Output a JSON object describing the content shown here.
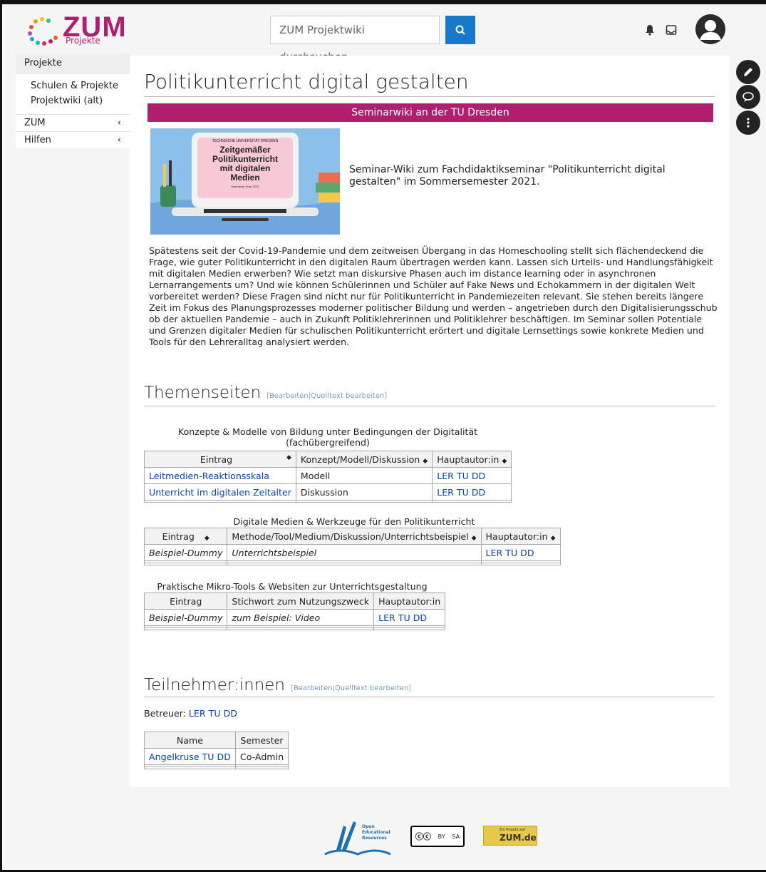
{
  "header": {
    "logo_text": "ZUM",
    "logo_sub": "Projekte",
    "search_placeholder": "ZUM Projektwiki durchsuchen"
  },
  "sidebar": {
    "head": "Projekte",
    "sub_items": [
      "Schulen & Projekte",
      "Projektwiki (alt)"
    ],
    "items": [
      {
        "label": "ZUM",
        "chevron": "‹"
      },
      {
        "label": "Hilfen",
        "chevron": "‹"
      }
    ]
  },
  "page": {
    "title": "Politikunterricht digital gestalten",
    "banner": "Seminarwiki an der TU Dresden",
    "hero": {
      "small": "TECHNISCHE UNIVERSITÄT DRESDEN",
      "l1": "Zeitgemäßer",
      "l2": "Politikunterricht",
      "l3": "mit digitalen",
      "l4": "Medien",
      "sub": "Sommerse­ Sose 2021"
    },
    "intro": "Seminar-Wiki zum Fachdidaktikseminar \"Politikunterricht digital gestalten\" im Sommersemester 2021.",
    "paragraph": "Spätestens seit der Covid-19-Pandemie und dem zeitweisen Übergang in das Homeschooling stellt sich flächendeckend die Frage, wie guter Politikunterricht in den digitalen Raum übertragen werden kann. Lassen sich Urteils- und Handlungsfähigkeit mit digitalen Medien erwerben? Wie setzt man diskursive Phasen auch im distance learning oder in asynchronen Lernarrangements um? Und wie können Schülerinnen und Schüler auf Fake News und Echokammern in der digitalen Welt vorbereitet werden? Diese Fragen sind nicht nur für Politikunterricht in Pandemiezeiten relevant. Sie stehen bereits längere Zeit im Fokus des Planungsprozesses moderner politischer Bildung und werden – angetrieben durch den Digitalisierungsschub ob der aktuellen Pandemie – auch in Zukunft Politiklehrerinnen und Politiklehrer beschäftigen. Im Seminar sollen Potentiale und Grenzen digitaler Medien für schulischen Politikunterricht erörtert und digitale Lernsettings sowie konkrete Medien und Tools für den Lehreralltag analysiert werden."
  },
  "edit": {
    "open": "[",
    "edit": "Bearbeiten",
    "sep": "|",
    "source": "Quelltext bearbeiten",
    "close": "]"
  },
  "themen": {
    "heading": "Themenseiten",
    "t1": {
      "caption": "Konzepte & Modelle von Bildung unter Bedingungen der Digitalität (fachübergreifend)",
      "headers": [
        "Eintrag",
        "Konzept/Modell/Diskussion",
        "Hauptautor:in"
      ],
      "rows": [
        [
          "Leitmedien-Reaktionsskala",
          "Modell",
          "LER TU DD"
        ],
        [
          "Unterricht im digitalen Zeitalter",
          "Diskussion",
          "LER TU DD"
        ]
      ]
    },
    "t2": {
      "caption": "Digitale Medien & Werkzeuge für den Politikunterricht",
      "headers": [
        "Eintrag",
        "Methode/Tool/Medium/Diskussion/Unterrichtsbeispiel",
        "Hauptautor:in"
      ],
      "rows": [
        [
          "Beispiel-Dummy",
          "Unterrichtsbeispiel",
          "LER TU DD"
        ]
      ]
    },
    "t3": {
      "caption": "Praktische Mikro-Tools & Websiten zur Unterrichtsgestaltung",
      "headers": [
        "Eintrag",
        "Stichwort zum Nutzungszweck",
        "Hauptautor:in"
      ],
      "rows": [
        [
          "Beispiel-Dummy",
          "zum Beispiel: Video",
          "LER TU DD"
        ]
      ]
    }
  },
  "teil": {
    "heading": "Teilnehmer:innen",
    "betreuer_label": "Betreuer:",
    "betreuer_link": "LER TU DD",
    "headers": [
      "Name",
      "Semester"
    ],
    "rows": [
      [
        "Angelkruse TU DD",
        "Co-Admin"
      ]
    ]
  },
  "footer": {
    "oer_text": "Open Educational Resources",
    "cc_by": "BY",
    "cc_sa": "SA",
    "zum_small": "Ein Projekt auf",
    "zum_big": "ZUM.de"
  },
  "icons": [
    "search-icon",
    "bell-icon",
    "inbox-icon",
    "avatar-icon",
    "pencil-icon",
    "chat-icon",
    "more-icon"
  ],
  "colors": {
    "brand": "#b01f6e",
    "link": "#0645ad",
    "search": "#1779c9"
  }
}
